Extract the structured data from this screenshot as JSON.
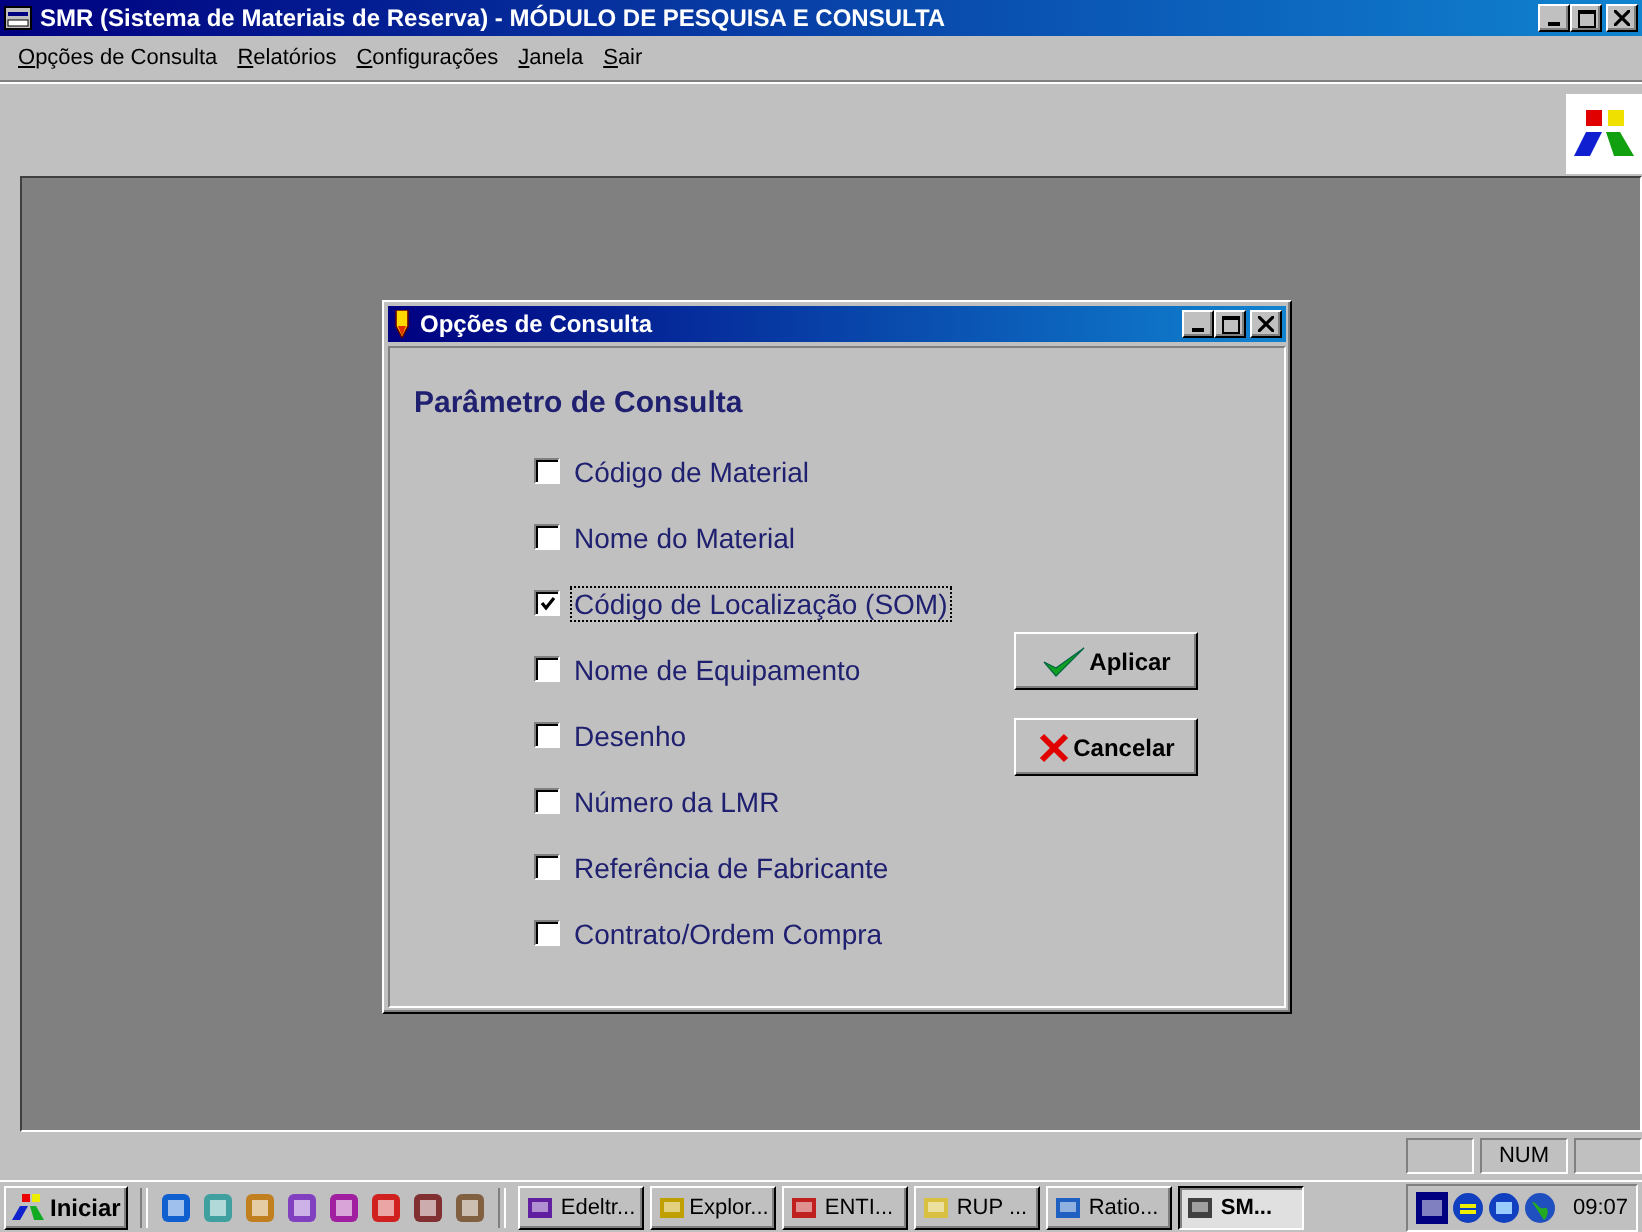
{
  "window": {
    "title": "SMR (Sistema de Materiais de Reserva) - MÓDULO DE PESQUISA E CONSULTA"
  },
  "menu": [
    {
      "label": "Opções de Consulta"
    },
    {
      "label": "Relatórios"
    },
    {
      "label": "Configurações"
    },
    {
      "label": "Janela"
    },
    {
      "label": "Sair"
    }
  ],
  "dialog": {
    "title": "Opções de Consulta",
    "heading": "Parâmetro de Consulta",
    "options": [
      {
        "label": "Código de Material",
        "checked": false,
        "focused": false
      },
      {
        "label": "Nome do Material",
        "checked": false,
        "focused": false
      },
      {
        "label": "Código de Localização (SOM)",
        "checked": true,
        "focused": true
      },
      {
        "label": "Nome de Equipamento",
        "checked": false,
        "focused": false
      },
      {
        "label": "Desenho",
        "checked": false,
        "focused": false
      },
      {
        "label": "Número da LMR",
        "checked": false,
        "focused": false
      },
      {
        "label": "Referência de Fabricante",
        "checked": false,
        "focused": false
      },
      {
        "label": "Contrato/Ordem Compra",
        "checked": false,
        "focused": false
      }
    ],
    "buttons": [
      {
        "label": "Aplicar",
        "kind": "apply"
      },
      {
        "label": "Cancelar",
        "kind": "cancel"
      }
    ]
  },
  "status_bar": {
    "indicator": "NUM"
  },
  "taskbar": {
    "start": "Iniciar",
    "tasks": [
      {
        "label": "Edeltr...",
        "selected": false
      },
      {
        "label": "Explor...",
        "selected": false
      },
      {
        "label": "ENTI...",
        "selected": false
      },
      {
        "label": "RUP ...",
        "selected": false
      },
      {
        "label": "Ratio...",
        "selected": false
      },
      {
        "label": "SM...",
        "selected": true
      }
    ],
    "clock": "09:07"
  }
}
